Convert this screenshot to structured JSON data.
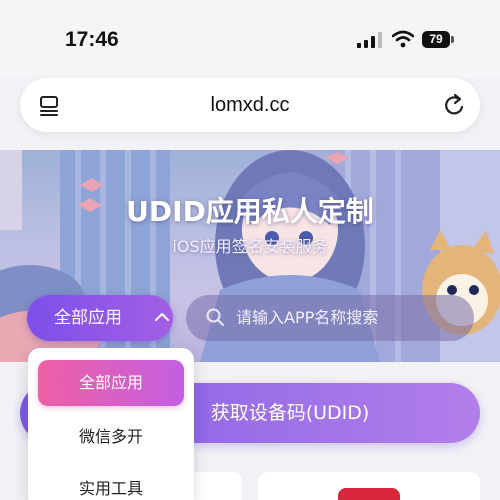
{
  "status_bar": {
    "time": "17:46",
    "battery": "79"
  },
  "browser": {
    "url": "lomxd.cc"
  },
  "hero": {
    "title": "UDID应用私人定制",
    "subtitle": "iOS应用签名安装服务"
  },
  "filter": {
    "category_selected": "全部应用",
    "search_placeholder": "请输入APP名称搜索"
  },
  "dropdown": {
    "items": [
      {
        "label": "全部应用",
        "active": true
      },
      {
        "label": "微信多开",
        "active": false
      },
      {
        "label": "实用工具",
        "active": false
      }
    ]
  },
  "actions": {
    "udid_button": "获取设备码(UDID)"
  },
  "colors": {
    "accent_purple": "#8b5ce8",
    "accent_pink": "#ee5fa3",
    "app_icon_red": "#d8263a"
  }
}
